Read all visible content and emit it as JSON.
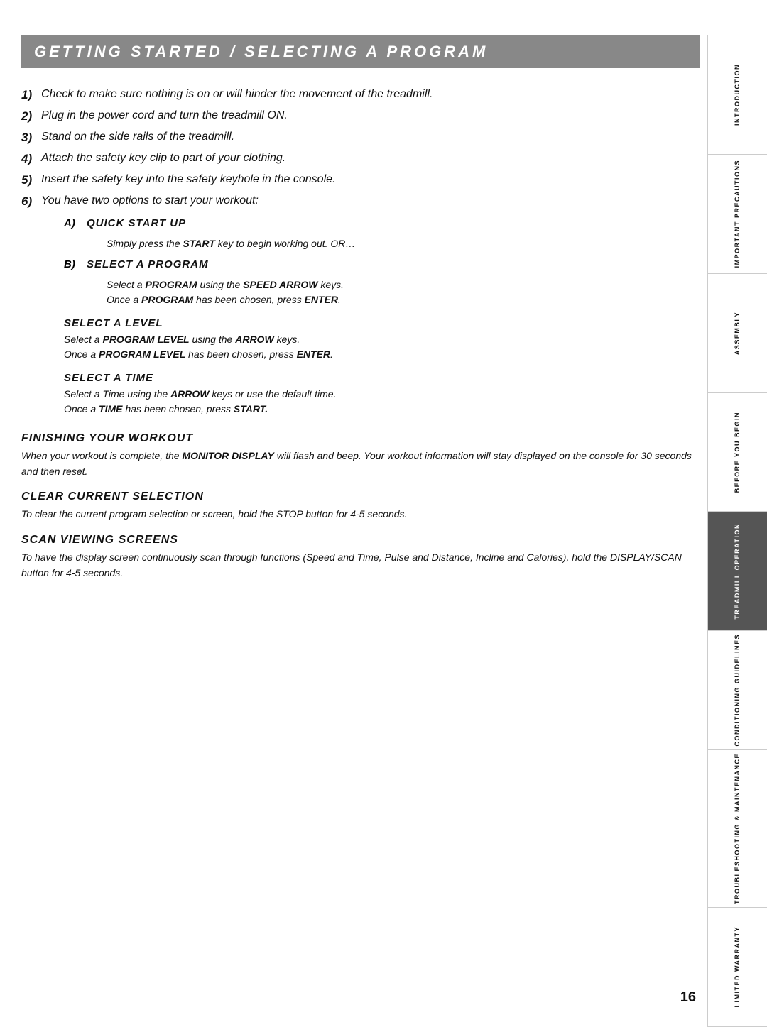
{
  "page": {
    "title": "GETTING STARTED / SELECTING A PROGRAM",
    "page_number": "16"
  },
  "steps": [
    {
      "num": "1)",
      "text": "Check to make sure nothing is on or will hinder the movement of the treadmill."
    },
    {
      "num": "2)",
      "text": "Plug in the power cord and turn the treadmill ON."
    },
    {
      "num": "3)",
      "text": "Stand on the side rails of the treadmill."
    },
    {
      "num": "4)",
      "text": "Attach the safety key clip to part of your clothing."
    },
    {
      "num": "5)",
      "text": "Insert the safety key into the safety keyhole in the console."
    },
    {
      "num": "6)",
      "text": "You have two options to start your workout:"
    }
  ],
  "sub_options": [
    {
      "alpha": "A)",
      "heading": "QUICK START UP",
      "body": "Simply press the START key to begin working out. OR…"
    },
    {
      "alpha": "B)",
      "heading": "SELECT A PROGRAM",
      "body_line1": "Select a PROGRAM using the SPEED ARROW keys.",
      "body_line2": "Once a PROGRAM has been chosen, press ENTER."
    }
  ],
  "select_level": {
    "heading": "SELECT A LEVEL",
    "body_line1": "Select a PROGRAM LEVEL using the ARROW keys.",
    "body_line2": "Once a PROGRAM LEVEL has been chosen, press ENTER."
  },
  "select_time": {
    "heading": "SELECT A TIME",
    "body_line1": "Select a Time using the ARROW keys or use the default time.",
    "body_line2": "Once a TIME has been chosen, press START."
  },
  "finishing": {
    "heading": "FINISHING YOUR WORKOUT",
    "body": "When your workout is complete, the MONITOR DISPLAY will flash and beep. Your workout information will stay displayed on the console for 30 seconds and then reset."
  },
  "clear": {
    "heading": "CLEAR CURRENT SELECTION",
    "body": "To clear the current program selection or screen, hold the STOP button for 4-5 seconds."
  },
  "scan": {
    "heading": "SCAN VIEWING SCREENS",
    "body": "To have the display screen continuously scan through functions (Speed and Time, Pulse and Distance, Incline and Calories), hold the DISPLAY/SCAN button for 4-5 seconds."
  },
  "sidebar": [
    {
      "label": "INTRODUCTION",
      "active": false
    },
    {
      "label": "IMPORTANT\nPRECAUTIONS",
      "active": false
    },
    {
      "label": "ASSEMBLY",
      "active": false
    },
    {
      "label": "BEFORE\nYOU BEGIN",
      "active": false
    },
    {
      "label": "TREADMILL\nOPERATION",
      "active": true
    },
    {
      "label": "CONDITIONING\nGUIDELINES",
      "active": false
    },
    {
      "label": "TROUBLESHOOTING\n& MAINTENANCE",
      "active": false
    },
    {
      "label": "LIMITED\nWARRANTY",
      "active": false
    }
  ]
}
